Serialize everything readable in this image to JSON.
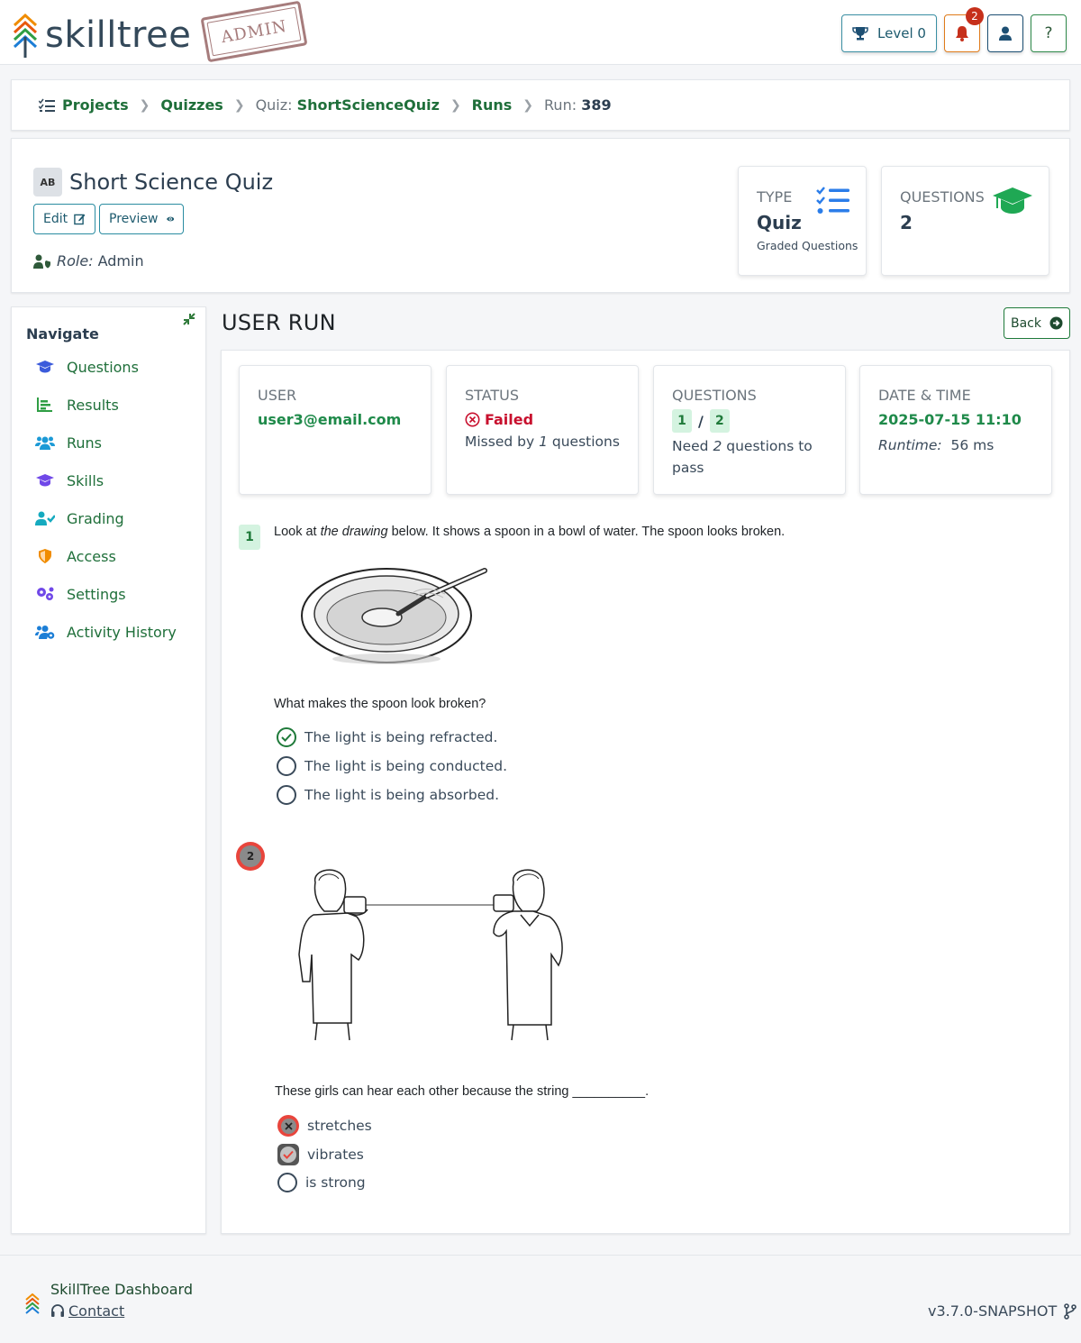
{
  "header": {
    "logo_text": "skilltree",
    "stamp": "ADMIN",
    "level_label": "Level 0",
    "notification_count": "2",
    "help_label": "?"
  },
  "breadcrumb": {
    "projects": "Projects",
    "quizzes": "Quizzes",
    "quiz_prefix": "Quiz: ",
    "quiz_name": "ShortScienceQuiz",
    "runs": "Runs",
    "run_prefix": "Run: ",
    "run_id": "389"
  },
  "quiz": {
    "icon_text": "AB",
    "title": "Short Science Quiz",
    "edit_label": "Edit",
    "preview_label": "Preview",
    "role_label": "Role:",
    "role_value": "Admin",
    "type_label": "TYPE",
    "type_value": "Quiz",
    "type_sub": "Graded Questions",
    "questions_label": "QUESTIONS",
    "questions_value": "2"
  },
  "nav": {
    "title": "Navigate",
    "items": [
      {
        "label": "Questions",
        "icon": "graduation-cap-icon",
        "color": "#3b5bdb"
      },
      {
        "label": "Results",
        "icon": "chart-bar-icon",
        "color": "#2f9e44"
      },
      {
        "label": "Runs",
        "icon": "users-icon",
        "color": "#1c9ad6"
      },
      {
        "label": "Skills",
        "icon": "graduation-cap-icon",
        "color": "#7048e8"
      },
      {
        "label": "Grading",
        "icon": "user-check-icon",
        "color": "#15aabf"
      },
      {
        "label": "Access",
        "icon": "shield-icon",
        "color": "#f08c00"
      },
      {
        "label": "Settings",
        "icon": "cogs-icon",
        "color": "#7048e8"
      },
      {
        "label": "Activity History",
        "icon": "users-cog-icon",
        "color": "#1c7ed6"
      }
    ]
  },
  "main": {
    "title": "USER RUN",
    "back_label": "Back",
    "user_label": "USER",
    "user_value": "user3@email.com",
    "status_label": "STATUS",
    "status_value": "Failed",
    "status_sub_pre": "Missed by ",
    "status_sub_num": "1",
    "status_sub_post": " questions",
    "questions_label": "QUESTIONS",
    "questions_correct": "1",
    "questions_sep": "/",
    "questions_total": "2",
    "need_pre": "Need ",
    "need_num": "2",
    "need_post": " questions to pass",
    "datetime_label": "DATE & TIME",
    "datetime_value": "2025-07-15 11:10",
    "runtime_label": "Runtime:",
    "runtime_value": "56 ms"
  },
  "questions": [
    {
      "number": "1",
      "text_pre": "Look at ",
      "text_em": "the drawing",
      "text_post": " below. It shows a spoon in a bowl of water. The spoon looks broken.",
      "prompt": "What makes the spoon look broken?",
      "answers": [
        {
          "text": "The light is being refracted.",
          "state": "correct-selected"
        },
        {
          "text": "The light is being conducted.",
          "state": "none"
        },
        {
          "text": "The light is being absorbed.",
          "state": "none"
        }
      ]
    },
    {
      "number": "2",
      "prompt": "These girls can hear each other because the string __________.",
      "answers": [
        {
          "text": "stretches",
          "state": "wrong-selected"
        },
        {
          "text": "vibrates",
          "state": "correct-missed"
        },
        {
          "text": "is strong",
          "state": "none"
        }
      ]
    }
  ],
  "footer": {
    "name": "SkillTree Dashboard",
    "contact": "Contact",
    "version": "v3.7.0-SNAPSHOT"
  }
}
